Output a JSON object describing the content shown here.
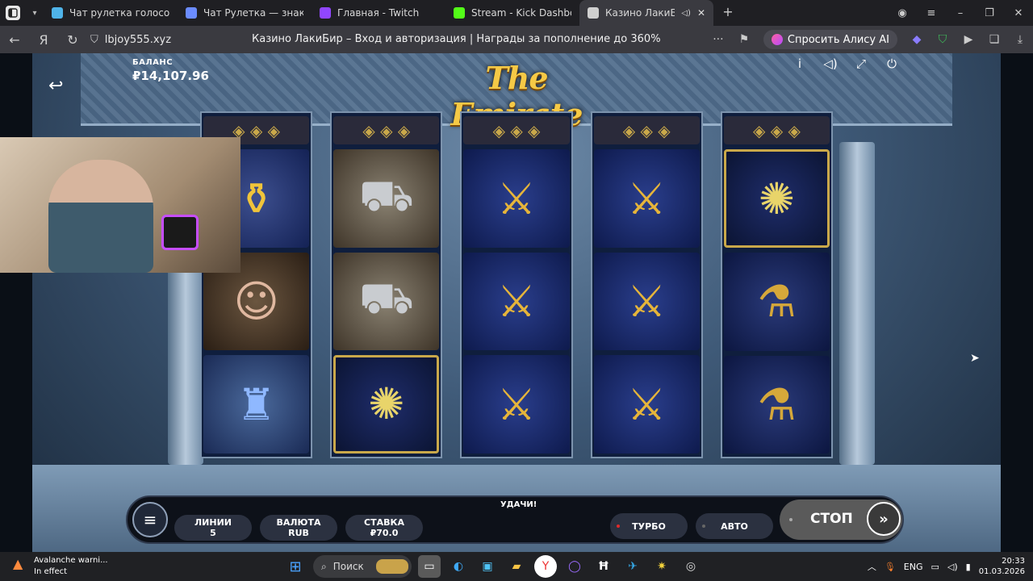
{
  "tabs": [
    {
      "label": "Чат рулетка голосовая –",
      "favicon_color": "#4fb3e8",
      "active": false
    },
    {
      "label": "Чат Рулетка — знакомств",
      "favicon_color": "#6b8cff",
      "active": false
    },
    {
      "label": "Главная - Twitch",
      "favicon_color": "#9146ff",
      "active": false
    },
    {
      "label": "Stream - Kick Dashboard",
      "favicon_color": "#53fc18",
      "active": false
    },
    {
      "label": "Казино ЛакиБир – В",
      "favicon_color": "#d0d0d0",
      "active": true
    }
  ],
  "browser": {
    "url": "lbjoy555.xyz",
    "page_title": "Казино ЛакиБир – Вход и авторизация | Награды за пополнение до 360%",
    "alice_label": "Спросить Алису AI"
  },
  "game": {
    "logo": "The Emirate",
    "balance_label": "БАЛАНС",
    "balance_value": "₽14,107.96",
    "message": "УДАЧИ!",
    "lines_label": "ЛИНИИ",
    "lines_value": "5",
    "currency_label": "ВАЛЮТА",
    "currency_value": "RUB",
    "bet_label": "СТАВКА",
    "bet_value": "₽70.0",
    "turbo_label": "ТУРБО",
    "turbo_indicator_color": "#e02a2a",
    "auto_label": "АВТО",
    "stop_label": "СТОП",
    "reels": [
      [
        "strip",
        "dallah",
        "lady",
        "city"
      ],
      [
        "strip",
        "truck",
        "truck",
        "palm"
      ],
      [
        "strip",
        "khanjar",
        "khanjar",
        "khanjar"
      ],
      [
        "strip",
        "khanjar",
        "khanjar",
        "khanjar"
      ],
      [
        "strip",
        "palm",
        "shisha",
        "shisha"
      ]
    ]
  },
  "taskbar": {
    "notification_title": "Avalanche warni...",
    "notification_sub": "In effect",
    "search_label": "Поиск",
    "lang": "ENG",
    "time": "20:33",
    "date": "01.03.2026"
  }
}
